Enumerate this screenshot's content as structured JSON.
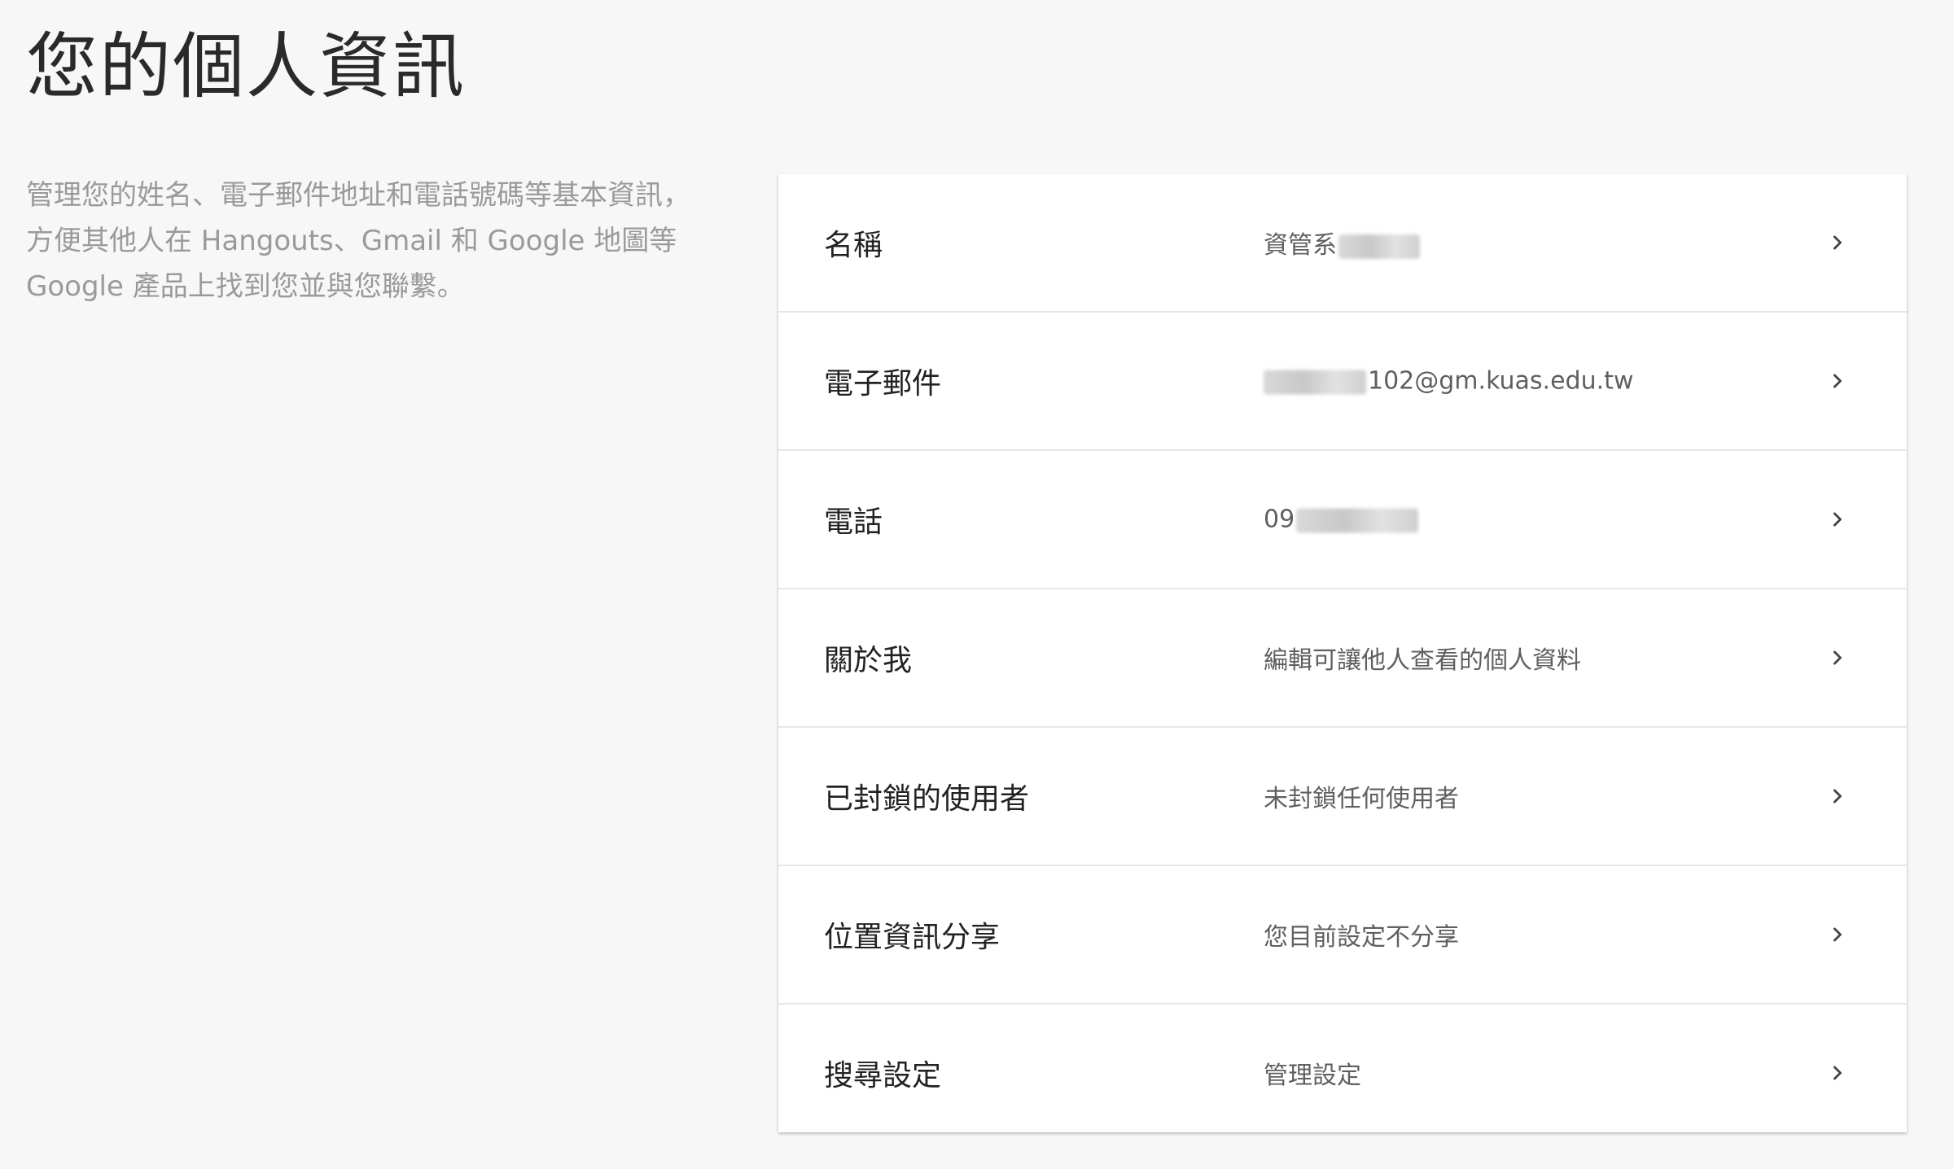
{
  "page": {
    "title": "您的個人資訊",
    "description": "管理您的姓名、電子郵件地址和電話號碼等基本資訊，方便其他人在 Hangouts、Gmail 和 Google 地圖等 Google 產品上找到您並與您聯繫。"
  },
  "rows": [
    {
      "label": "名稱",
      "value": "資管系",
      "redacted": true
    },
    {
      "label": "電子郵件",
      "value": "102@gm.kuas.edu.tw",
      "redacted": true
    },
    {
      "label": "電話",
      "value": "09",
      "redacted": true
    },
    {
      "label": "關於我",
      "value": "編輯可讓他人查看的個人資料",
      "redacted": false
    },
    {
      "label": "已封鎖的使用者",
      "value": "未封鎖任何使用者",
      "redacted": false
    },
    {
      "label": "位置資訊分享",
      "value": "您目前設定不分享",
      "redacted": false
    },
    {
      "label": "搜尋設定",
      "value": "管理設定",
      "redacted": false
    }
  ],
  "icons": {
    "row_action": "chevron-right-icon"
  },
  "colors": {
    "background": "#f7f7f7",
    "card": "#ffffff",
    "divider": "#e6e6e6",
    "description_text": "#9a9a9a"
  }
}
